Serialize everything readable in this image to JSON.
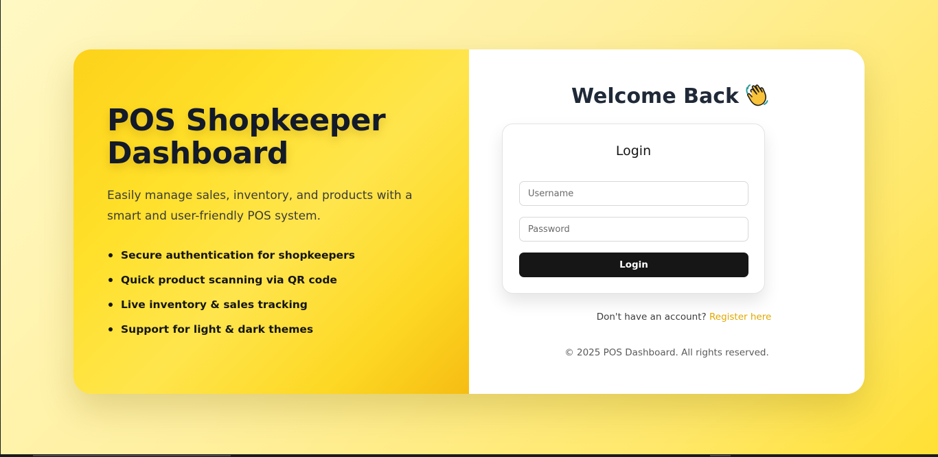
{
  "brand": {
    "title_line1": "POS Shopkeeper",
    "title_line2": "Dashboard",
    "description": "Easily manage sales, inventory, and products with a smart and user-friendly POS system.",
    "features": [
      "Secure authentication for shopkeepers",
      "Quick product scanning via QR code",
      "Live inventory & sales tracking",
      "Support for light & dark themes"
    ]
  },
  "auth": {
    "welcome": "Welcome Back",
    "welcome_icon": "waving-hand-icon",
    "form_title": "Login",
    "username_placeholder": "Username",
    "username_value": "",
    "password_placeholder": "Password",
    "password_value": "",
    "submit_label": "Login",
    "register_prompt": "Don't have an account?",
    "register_link": "Register here"
  },
  "footer": {
    "copyright": "© 2025 POS Dashboard. All rights reserved."
  },
  "colors": {
    "accent": "#fdd824",
    "link": "#e0a800",
    "button": "#161616",
    "heading": "#131a2a"
  }
}
